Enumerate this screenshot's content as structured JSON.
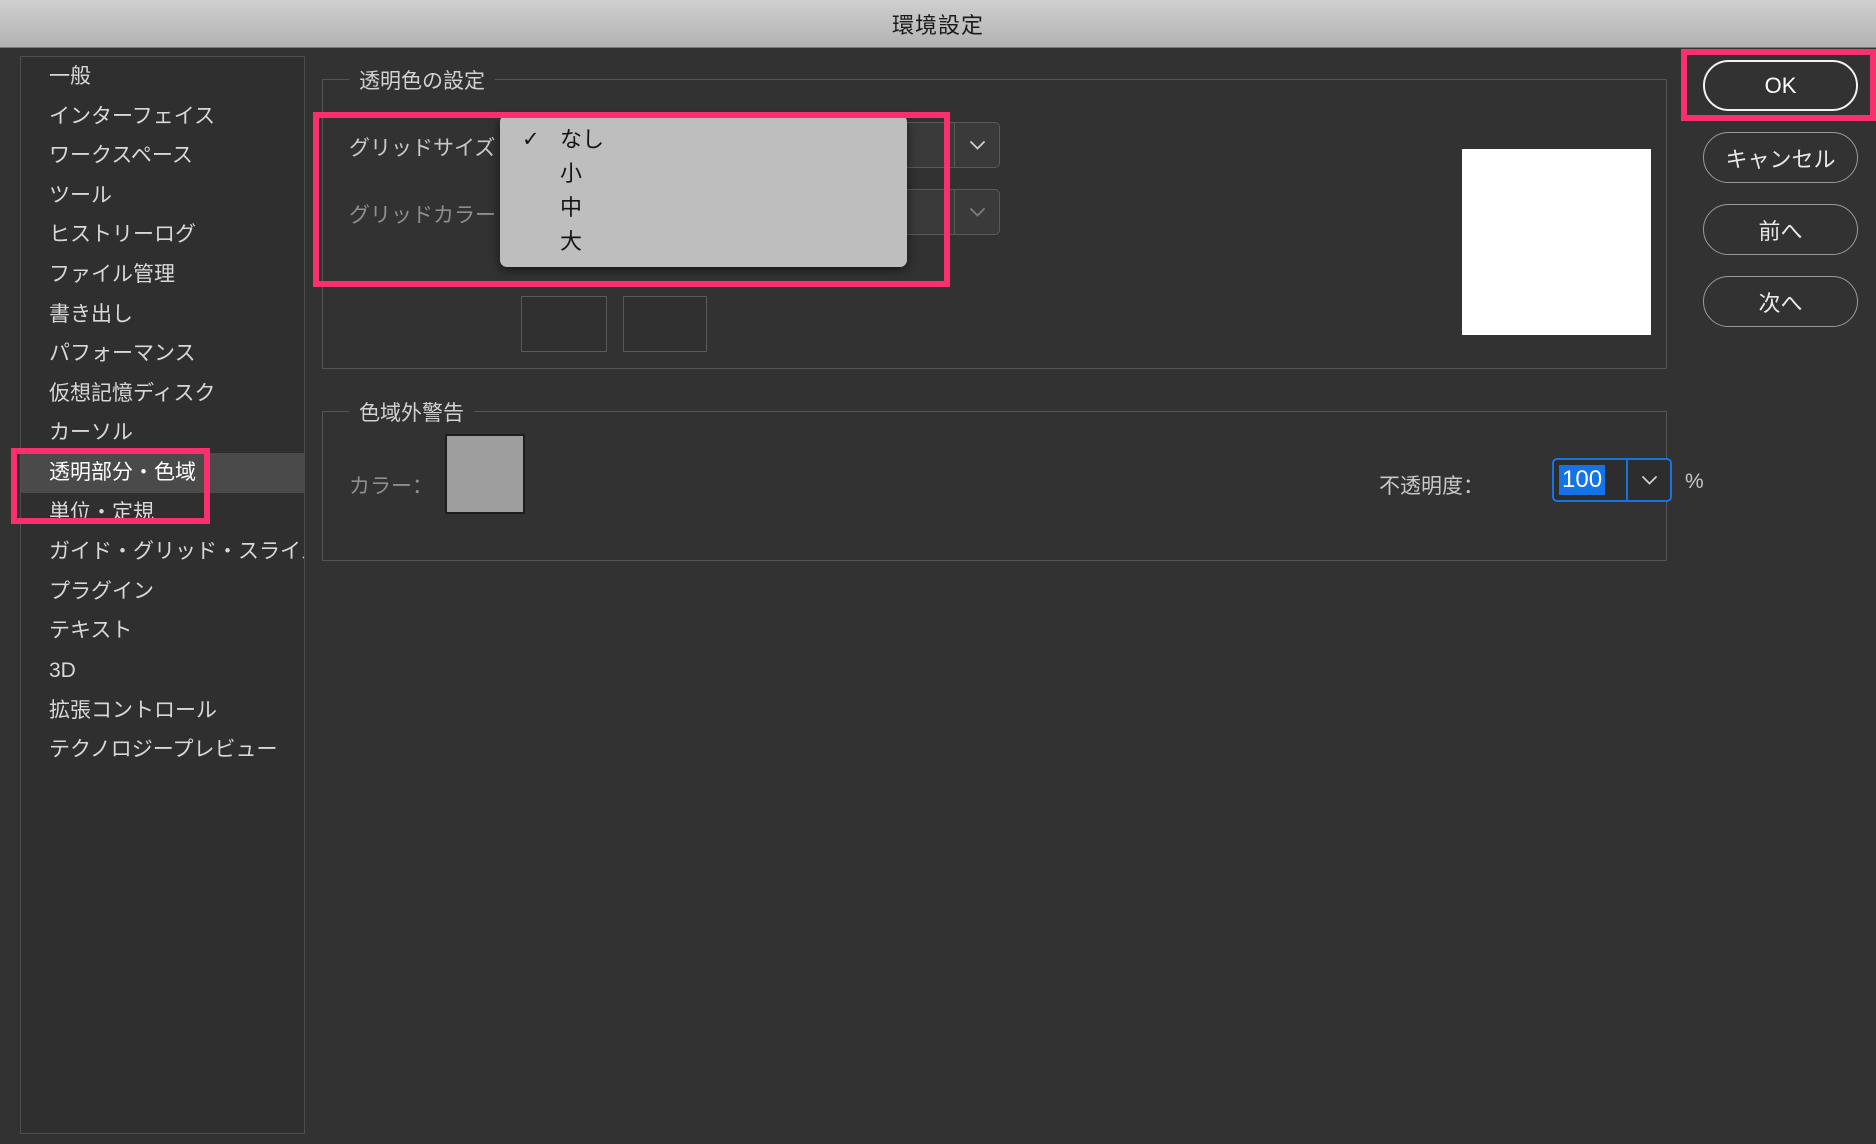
{
  "window": {
    "title": "環境設定"
  },
  "sidebar": {
    "items": [
      {
        "label": "一般",
        "selected": false
      },
      {
        "label": "インターフェイス",
        "selected": false
      },
      {
        "label": "ワークスペース",
        "selected": false
      },
      {
        "label": "ツール",
        "selected": false
      },
      {
        "label": "ヒストリーログ",
        "selected": false
      },
      {
        "label": "ファイル管理",
        "selected": false
      },
      {
        "label": "書き出し",
        "selected": false
      },
      {
        "label": "パフォーマンス",
        "selected": false
      },
      {
        "label": "仮想記憶ディスク",
        "selected": false
      },
      {
        "label": "カーソル",
        "selected": false
      },
      {
        "label": "透明部分・色域",
        "selected": true
      },
      {
        "label": "単位・定規",
        "selected": false
      },
      {
        "label": "ガイド・グリッド・スライス",
        "selected": false
      },
      {
        "label": "プラグイン",
        "selected": false
      },
      {
        "label": "テキスト",
        "selected": false
      },
      {
        "label": "3D",
        "selected": false
      },
      {
        "label": "拡張コントロール",
        "selected": false
      },
      {
        "label": "テクノロジープレビュー",
        "selected": false
      }
    ]
  },
  "transparency_group": {
    "legend": "透明色の設定",
    "grid_size_label": "グリッドサイズ",
    "grid_size_value": "",
    "grid_color_label": "グリッドカラー",
    "grid_color_value": ""
  },
  "gamut_group": {
    "legend": "色域外警告",
    "color_label": "カラー：",
    "color_swatch_hex": "#9e9e9e",
    "opacity_label": "不透明度：",
    "opacity_value": "100",
    "opacity_unit": "%"
  },
  "dropdown": {
    "open": true,
    "check_glyph": "✓",
    "items": [
      {
        "label": "なし",
        "checked": true
      },
      {
        "label": "小",
        "checked": false
      },
      {
        "label": "中",
        "checked": false
      },
      {
        "label": "大",
        "checked": false
      }
    ]
  },
  "buttons": [
    {
      "label": "OK",
      "primary": true
    },
    {
      "label": "キャンセル",
      "primary": false
    },
    {
      "label": "前へ",
      "primary": false
    },
    {
      "label": "次へ",
      "primary": false
    }
  ],
  "colors": {
    "highlight": "#fa2f6e",
    "accent_focus": "#1473e6",
    "preview_swatch": "#ffffff",
    "window_bg": "#323232",
    "popup_bg": "#bebebe"
  }
}
